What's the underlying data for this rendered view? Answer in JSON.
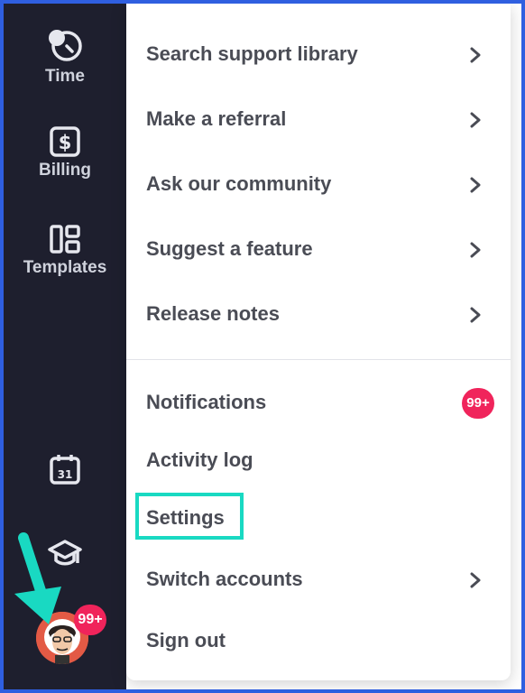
{
  "sidebar": {
    "items": [
      {
        "label": "Time",
        "icon": "stopwatch-icon"
      },
      {
        "label": "Billing",
        "icon": "dollar-icon"
      },
      {
        "label": "Templates",
        "icon": "templates-icon"
      }
    ],
    "calendar_day": "31",
    "avatar_badge": "99+"
  },
  "menu": {
    "top_items": [
      {
        "label": "Search support library"
      },
      {
        "label": "Make a referral"
      },
      {
        "label": "Ask our community"
      },
      {
        "label": "Suggest a feature"
      },
      {
        "label": "Release notes"
      }
    ],
    "notifications": {
      "label": "Notifications",
      "badge": "99+"
    },
    "activity_log": {
      "label": "Activity log"
    },
    "settings": {
      "label": "Settings"
    },
    "switch_accounts": {
      "label": "Switch accounts"
    },
    "sign_out": {
      "label": "Sign out"
    }
  },
  "colors": {
    "sidebar_bg": "#1e1f2e",
    "badge": "#f0245b",
    "highlight": "#19d9c2",
    "frame_border": "#2f5fe0"
  }
}
